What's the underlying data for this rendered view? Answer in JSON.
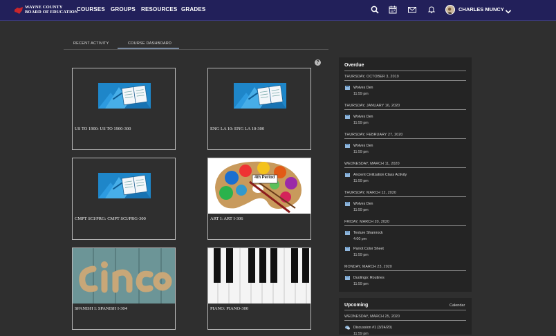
{
  "header": {
    "logo_line1": "WAYNE COUNTY",
    "logo_line2": "BOARD OF EDUCATION",
    "nav": [
      "COURSES",
      "GROUPS",
      "RESOURCES",
      "GRADES"
    ],
    "user_name": "CHARLES MUNCY",
    "icons": [
      "search-icon",
      "calendar-icon",
      "mail-icon",
      "bell-icon",
      "chevron-down-icon"
    ]
  },
  "tabs": {
    "recent": "RECENT ACTIVITY",
    "dashboard": "COURSE DASHBOARD",
    "active": "dashboard"
  },
  "help_glyph": "?",
  "courses": [
    {
      "title": "US TO 1900: US TO 1900-300",
      "image": "default-book"
    },
    {
      "title": "ENG LA 10: ENG LA 10-300",
      "image": "default-book"
    },
    {
      "title": "CMPT SCI/PRG: CMPT SCI/PRG-300",
      "image": "default-book"
    },
    {
      "title": "ART I: ART I-306",
      "image": "paint-palette",
      "badge": "4th Period"
    },
    {
      "title": "SPANISH I: SPANISH I-304",
      "image": "cinco-wood"
    },
    {
      "title": "PIANO: PIANO-300",
      "image": "piano-keys"
    }
  ],
  "overdue": {
    "title": "Overdue",
    "groups": [
      {
        "date": "THURSDAY, OCTOBER 3, 2019",
        "items": [
          {
            "name": "Wolves Den",
            "time": "11:59 pm"
          }
        ]
      },
      {
        "date": "THURSDAY, JANUARY 16, 2020",
        "items": [
          {
            "name": "Wolves Den",
            "time": "11:59 pm"
          }
        ]
      },
      {
        "date": "THURSDAY, FEBRUARY 27, 2020",
        "items": [
          {
            "name": "Wolves Den",
            "time": "11:59 pm"
          }
        ]
      },
      {
        "date": "WEDNESDAY, MARCH 11, 2020",
        "items": [
          {
            "name": "Ancient Civilization Class Activity",
            "time": "11:59 pm"
          }
        ]
      },
      {
        "date": "THURSDAY, MARCH 12, 2020",
        "items": [
          {
            "name": "Wolves Den",
            "time": "11:59 pm"
          }
        ]
      },
      {
        "date": "FRIDAY, MARCH 20, 2020",
        "items": [
          {
            "name": "Texture Shamrock",
            "time": "4:00 pm"
          },
          {
            "name": "Parrot Color Sheet",
            "time": "11:59 pm"
          }
        ]
      },
      {
        "date": "MONDAY, MARCH 23, 2020",
        "items": [
          {
            "name": "Duolingo: Routines",
            "time": "11:59 pm"
          }
        ]
      }
    ]
  },
  "upcoming": {
    "title": "Upcoming",
    "calendar_link": "Calendar",
    "groups": [
      {
        "date": "WEDNESDAY, MARCH 25, 2020",
        "items": [
          {
            "name": "Discussion #1 (3/24/20)",
            "time": "11:59 pm"
          }
        ]
      }
    ]
  },
  "colors": {
    "topbar": "#22205a",
    "background": "#2f2f2f",
    "panel": "#242424",
    "book_blue": "#1e86c9"
  }
}
